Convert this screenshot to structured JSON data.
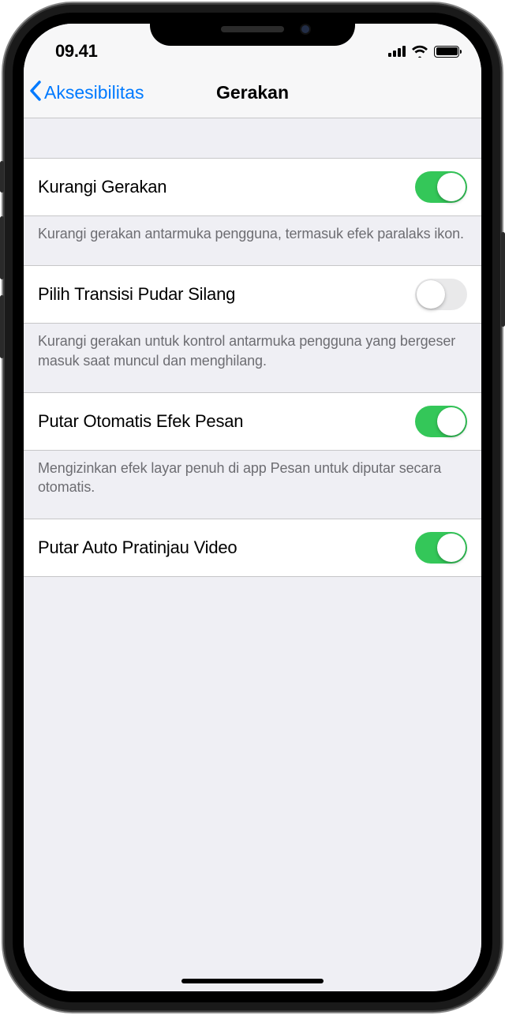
{
  "status": {
    "time": "09.41"
  },
  "nav": {
    "back_label": "Aksesibilitas",
    "title": "Gerakan"
  },
  "settings": [
    {
      "label": "Kurangi Gerakan",
      "enabled": true,
      "footer": "Kurangi gerakan antarmuka pengguna, termasuk efek paralaks ikon."
    },
    {
      "label": "Pilih Transisi Pudar Silang",
      "enabled": false,
      "footer": "Kurangi gerakan untuk kontrol antarmuka pengguna yang bergeser masuk saat muncul dan menghilang."
    },
    {
      "label": "Putar Otomatis Efek Pesan",
      "enabled": true,
      "footer": "Mengizinkan efek layar penuh di app Pesan untuk diputar secara otomatis."
    },
    {
      "label": "Putar Auto Pratinjau Video",
      "enabled": true,
      "footer": ""
    }
  ]
}
